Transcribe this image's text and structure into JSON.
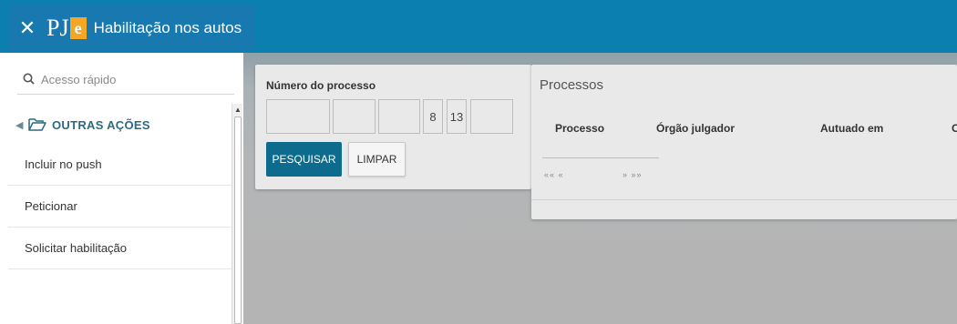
{
  "header": {
    "close_glyph": "✕",
    "logo_text": "PJ",
    "logo_badge": "e",
    "title": "Habilitação nos autos",
    "bar_color": "#0b80b0"
  },
  "sidebar": {
    "search": {
      "placeholder": "Acesso rápido"
    },
    "section": {
      "label": "OUTRAS AÇÕES"
    },
    "items": [
      {
        "label": "Incluir no push"
      },
      {
        "label": "Peticionar"
      },
      {
        "label": "Solicitar habilitação"
      }
    ]
  },
  "search_panel": {
    "heading": "Número do processo",
    "fields": [
      "",
      "",
      "",
      "8",
      "13",
      ""
    ],
    "search_button": "PESQUISAR",
    "clear_button": "LIMPAR",
    "accent_color": "#0d6c8d"
  },
  "results_panel": {
    "heading": "Processos",
    "columns": [
      "Processo",
      "Órgão julgador",
      "Autuado em",
      "C"
    ],
    "pager_prev": "«« «",
    "pager_next": "» »»"
  }
}
